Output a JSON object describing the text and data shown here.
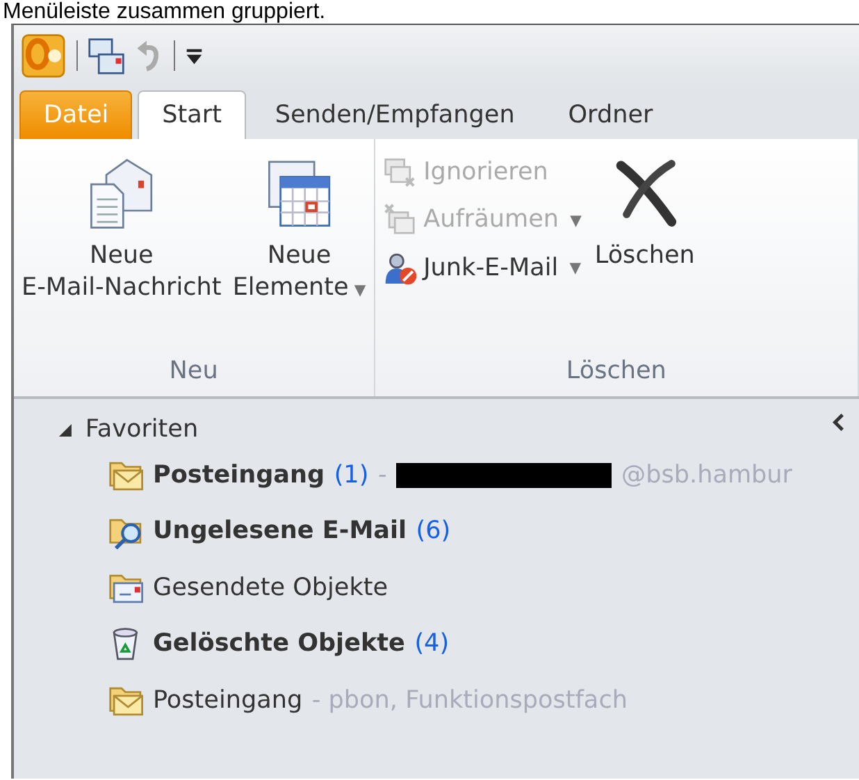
{
  "caption": "Menüleiste zusammen gruppiert.",
  "tabs": [
    {
      "label": "Datei",
      "kind": "file",
      "selected": false
    },
    {
      "label": "Start",
      "kind": "tab",
      "selected": true
    },
    {
      "label": "Senden/Empfangen",
      "kind": "tab",
      "selected": false
    },
    {
      "label": "Ordner",
      "kind": "tab",
      "selected": false
    }
  ],
  "ribbon_groups": [
    {
      "label": "Neu",
      "buttons": [
        {
          "kind": "large",
          "lines": [
            "Neue",
            "E-Mail-Nachricht"
          ]
        },
        {
          "kind": "large",
          "lines": [
            "Neue",
            "Elemente"
          ],
          "caret": "▼"
        }
      ]
    },
    {
      "label": "Löschen",
      "buttons": [
        {
          "kind": "stack",
          "items": [
            {
              "label": "Ignorieren",
              "disabled": true
            },
            {
              "label": "Aufräumen",
              "caret": "▼",
              "disabled": true
            },
            {
              "label": "Junk-E-Mail",
              "caret": "▼",
              "disabled": false
            }
          ]
        },
        {
          "kind": "large",
          "lines": [
            "Löschen"
          ]
        }
      ]
    }
  ],
  "nav": {
    "section": "Favoriten",
    "expanded": true,
    "folders": [
      {
        "name": "Posteingang",
        "kind": "inbox",
        "unread": true,
        "count": "(1)",
        "account": "-",
        "redacted": true,
        "account_tail": "@bsb.hambur"
      },
      {
        "name": "Ungelesene E-Mail",
        "kind": "search",
        "unread": true,
        "count": "(6)"
      },
      {
        "name": "Gesendete Objekte",
        "kind": "sent",
        "unread": false
      },
      {
        "name": "Gelöschte Objekte",
        "kind": "trash",
        "unread": true,
        "count": "(4)"
      },
      {
        "name": "Posteingang",
        "kind": "inbox",
        "unread": false,
        "account": "- pbon, Funktionspostfach"
      }
    ]
  }
}
